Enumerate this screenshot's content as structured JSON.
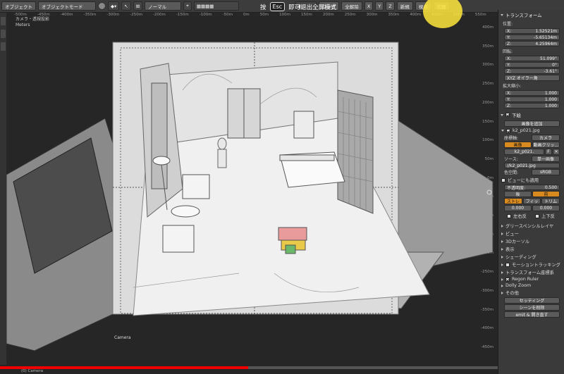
{
  "toolbar": {
    "object_menu": "オブジェクト",
    "object_mode": "オブジェクトモード",
    "shading": "ノーマル",
    "lock_label": "ロック",
    "global_label": "全解除",
    "axis_x": "X",
    "axis_y": "Y",
    "axis_z": "Z",
    "new_label": "新規",
    "view_label": "視点",
    "switch_label": "切替"
  },
  "fullscreen_hint": {
    "press": "按",
    "key": "Esc",
    "message": "即可退出全屏模式"
  },
  "viewport": {
    "title": "カメラ・透視投影",
    "units": "Meters",
    "camera_label": "Camera",
    "bottom_label": "(0) Camera",
    "ruler_top": [
      "-500m",
      "-450m",
      "-400m",
      "-350m",
      "-300m",
      "-250m",
      "-200m",
      "-150m",
      "-100m",
      "-50m",
      "0m",
      "50m",
      "100m",
      "150m",
      "200m",
      "250m",
      "300m",
      "350m",
      "400m",
      "450m",
      "500m",
      "550m"
    ],
    "ruler_right": [
      "400m",
      "350m",
      "300m",
      "250m",
      "200m",
      "150m",
      "100m",
      "50m",
      "0m",
      "-50m",
      "-100m",
      "-150m",
      "-200m",
      "-250m",
      "-300m",
      "-350m",
      "-400m",
      "-450m"
    ]
  },
  "n_panel": {
    "transform_header": "トランスフォーム",
    "location_label": "位置:",
    "location": [
      {
        "axis": "X:",
        "value": "1.52521m"
      },
      {
        "axis": "Y:",
        "value": "-5.65134m"
      },
      {
        "axis": "Z:",
        "value": "4.25964m"
      }
    ],
    "rotation_label": "回転:",
    "rotation": [
      {
        "axis": "X:",
        "value": "51.099°"
      },
      {
        "axis": "Y:",
        "value": "0°"
      },
      {
        "axis": "Z:",
        "value": "-3.61°"
      }
    ],
    "rotation_mode": "XYZ オイラー角",
    "scale_label": "拡大縮小:",
    "scale": [
      {
        "axis": "X:",
        "value": "1.000"
      },
      {
        "axis": "Y:",
        "value": "1.000"
      },
      {
        "axis": "Z:",
        "value": "1.000"
      }
    ],
    "background_header": "下絵",
    "add_image": "画像を追加",
    "image_name": "k2_p021.jpg",
    "axis_label": "座標軸:",
    "axis_value": "カメラ",
    "tab_image": "画像",
    "tab_movie": "動画クリッ...",
    "image_slot": "k2_p021.",
    "image_slot_f": "F",
    "source_label": "ソース:",
    "source_value": "単一画像",
    "file_path": "//k2_p021.jpg",
    "colorspace_label": "色空間:",
    "colorspace_value": "sRGB",
    "view_as_render": "ビューにも適用",
    "opacity_label": "不透明度:",
    "opacity_value": "0.500",
    "back": "後",
    "front": "前",
    "stretch": "ストレ",
    "fit": "フィッ",
    "crop": "トリム",
    "offset_x": "0.000",
    "offset_y": "0.000",
    "flip_x": "左右反",
    "flip_y": "上下反",
    "sections": [
      "グリースペンシルレイヤ",
      "ビュー",
      "3Dカーソル",
      "表示",
      "シェーディング",
      "モーショントラッキング",
      "トランスフォーム座標系",
      "Regon Ruler",
      "Dolly Zoom",
      "その他"
    ],
    "settings_btn": "セッティング",
    "reset_scene": "シーンを削除",
    "more_btn": "emit & 開き直す"
  },
  "progress": {
    "fraction": 0.44
  },
  "colors": {
    "accent": "#d98a1f",
    "highlight": "#f5d83a",
    "progress": "#ee0000"
  }
}
